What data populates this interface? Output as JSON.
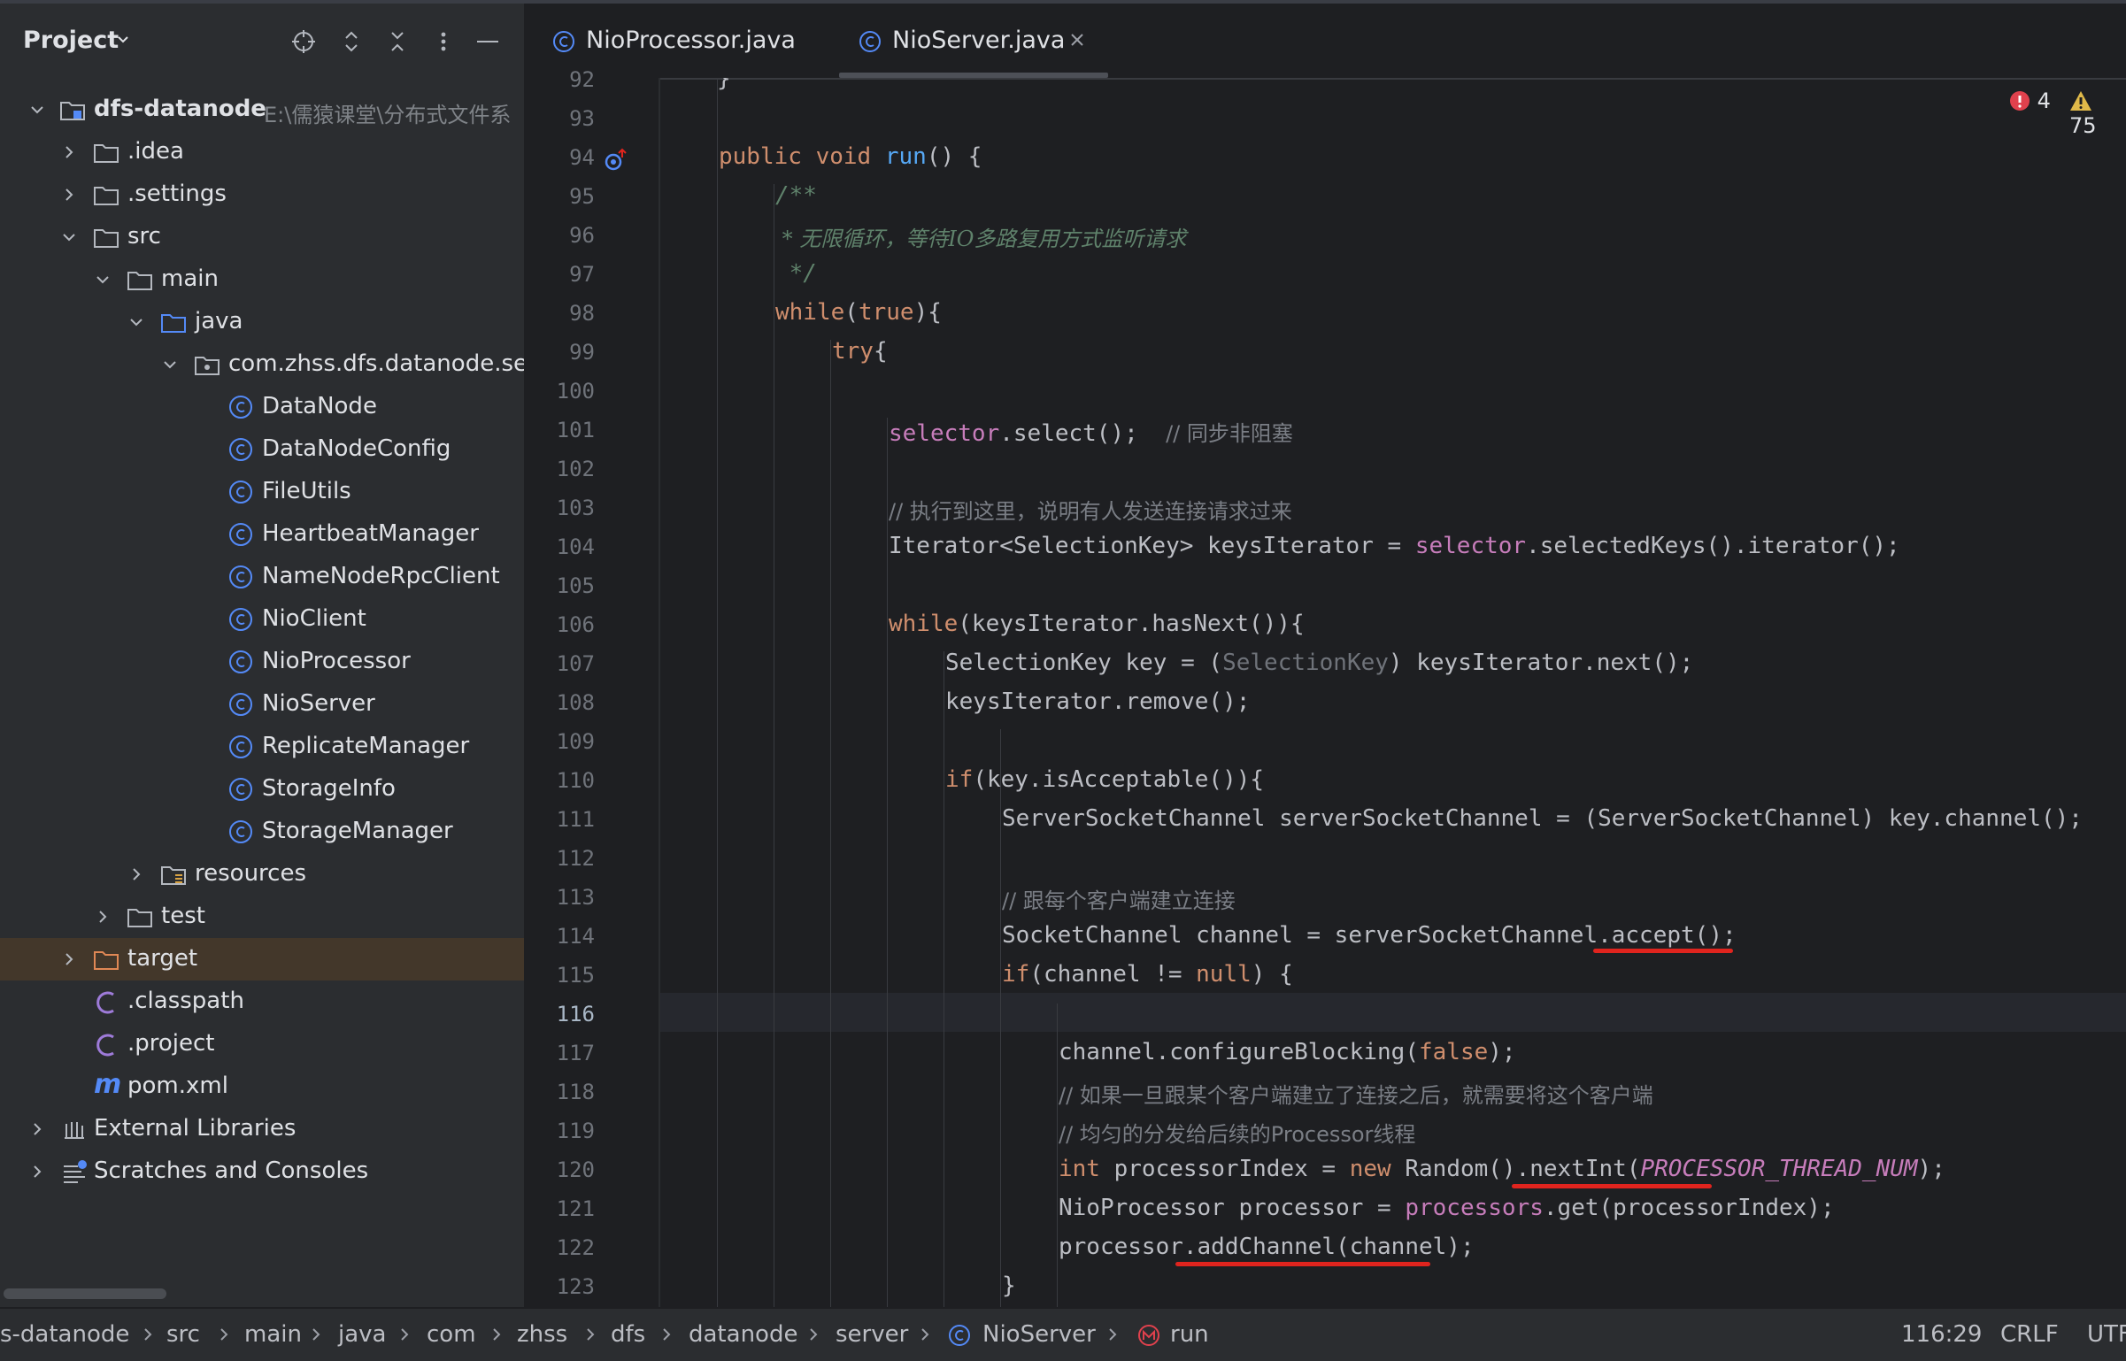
{
  "sidebar": {
    "title": "Project",
    "tree": [
      {
        "label": "dfs-datanode",
        "hint": "E:\\儒猿课堂\\分布式文件系",
        "icon": "module-folder-icon",
        "bold": true
      },
      {
        "label": ".idea",
        "icon": "folder-icon"
      },
      {
        "label": ".settings",
        "icon": "folder-icon"
      },
      {
        "label": "src",
        "icon": "folder-icon"
      },
      {
        "label": "main",
        "icon": "folder-icon"
      },
      {
        "label": "java",
        "icon": "source-folder-icon"
      },
      {
        "label": "com.zhss.dfs.datanode.ser",
        "icon": "package-icon"
      },
      {
        "label": "DataNode",
        "icon": "class-icon"
      },
      {
        "label": "DataNodeConfig",
        "icon": "class-icon"
      },
      {
        "label": "FileUtils",
        "icon": "class-icon"
      },
      {
        "label": "HeartbeatManager",
        "icon": "class-icon"
      },
      {
        "label": "NameNodeRpcClient",
        "icon": "class-icon"
      },
      {
        "label": "NioClient",
        "icon": "class-icon"
      },
      {
        "label": "NioProcessor",
        "icon": "class-icon"
      },
      {
        "label": "NioServer",
        "icon": "class-icon"
      },
      {
        "label": "ReplicateManager",
        "icon": "class-icon"
      },
      {
        "label": "StorageInfo",
        "icon": "class-icon"
      },
      {
        "label": "StorageManager",
        "icon": "class-icon"
      },
      {
        "label": "resources",
        "icon": "resources-folder-icon"
      },
      {
        "label": "test",
        "icon": "folder-icon"
      },
      {
        "label": "target",
        "icon": "excluded-folder-icon"
      },
      {
        "label": ".classpath",
        "icon": "eclipse-file-icon"
      },
      {
        "label": ".project",
        "icon": "eclipse-file-icon"
      },
      {
        "label": "pom.xml",
        "icon": "maven-icon"
      },
      {
        "label": "External Libraries",
        "icon": "libraries-icon"
      },
      {
        "label": "Scratches and Consoles",
        "icon": "scratches-icon"
      }
    ]
  },
  "tabs": [
    {
      "label": "NioProcessor.java",
      "active": false
    },
    {
      "label": "NioServer.java",
      "active": true
    }
  ],
  "inspection": {
    "errors": "4",
    "warnings": "75"
  },
  "lines": [
    "92",
    "93",
    "94",
    "95",
    "96",
    "97",
    "98",
    "99",
    "100",
    "101",
    "102",
    "103",
    "104",
    "105",
    "106",
    "107",
    "108",
    "109",
    "110",
    "111",
    "112",
    "113",
    "114",
    "115",
    "116",
    "117",
    "118",
    "119",
    "120",
    "121",
    "122",
    "123"
  ],
  "code": {
    "l92": "}",
    "l94_a": "public void ",
    "l94_b": "run",
    "l94_c": "() {",
    "l95": "/**",
    "l96": " * 无限循环，等待IO多路复用方式监听请求",
    "l97": " */",
    "l98_a": "while",
    "l98_b": "(",
    "l98_c": "true",
    "l98_d": "){",
    "l99_a": "try",
    "l99_b": "{",
    "l101_a": "selector",
    "l101_b": ".select();  ",
    "l101_c": "// 同步非阻塞",
    "l103": "// 执行到这里，说明有人发送连接请求过来",
    "l104_a": "Iterator<SelectionKey> keysIterator = ",
    "l104_b": "selector",
    "l104_c": ".selectedKeys().iterator();",
    "l106_a": "while",
    "l106_b": "(keysIterator.hasNext()){",
    "l107_a": "SelectionKey key = (",
    "l107_b": "SelectionKey",
    "l107_c": ") keysIterator.next();",
    "l108": "keysIterator.remove();",
    "l110_a": "if",
    "l110_b": "(key.isAcceptable()){",
    "l111": "ServerSocketChannel serverSocketChannel = (ServerSocketChannel) key.channel();",
    "l113": "// 跟每个客户端建立连接",
    "l114": "SocketChannel channel = serverSocketChannel.accept();",
    "l115_a": "if",
    "l115_b": "(channel != ",
    "l115_c": "null",
    "l115_d": ") {",
    "l117_a": "channel.configureBlocking(",
    "l117_b": "false",
    "l117_c": ");",
    "l118": "// 如果一旦跟某个客户端建立了连接之后，就需要将这个客户端",
    "l119": "// 均匀的分发给后续的Processor线程",
    "l120_a": "int ",
    "l120_b": "processorIndex = ",
    "l120_c": "new ",
    "l120_d": "Random().nextInt(",
    "l120_e": "PROCESSOR_THREAD_NUM",
    "l120_f": ");",
    "l121_a": "NioProcessor processor = ",
    "l121_b": "processors",
    "l121_c": ".get(processorIndex);",
    "l122": "processor.addChannel(channel);",
    "l123": "}"
  },
  "breadcrumb": [
    "s-datanode",
    "src",
    "main",
    "java",
    "com",
    "zhss",
    "dfs",
    "datanode",
    "server",
    "NioServer",
    "run"
  ],
  "status": {
    "cursor": "116:29",
    "line_ending": "CRLF",
    "encoding": "UTF-"
  },
  "colors": {
    "accent_class": "#548af7",
    "keyword": "#cf8e6d",
    "field": "#c77dbb",
    "function": "#56a8f5",
    "annotation_red": "#e0241e"
  }
}
